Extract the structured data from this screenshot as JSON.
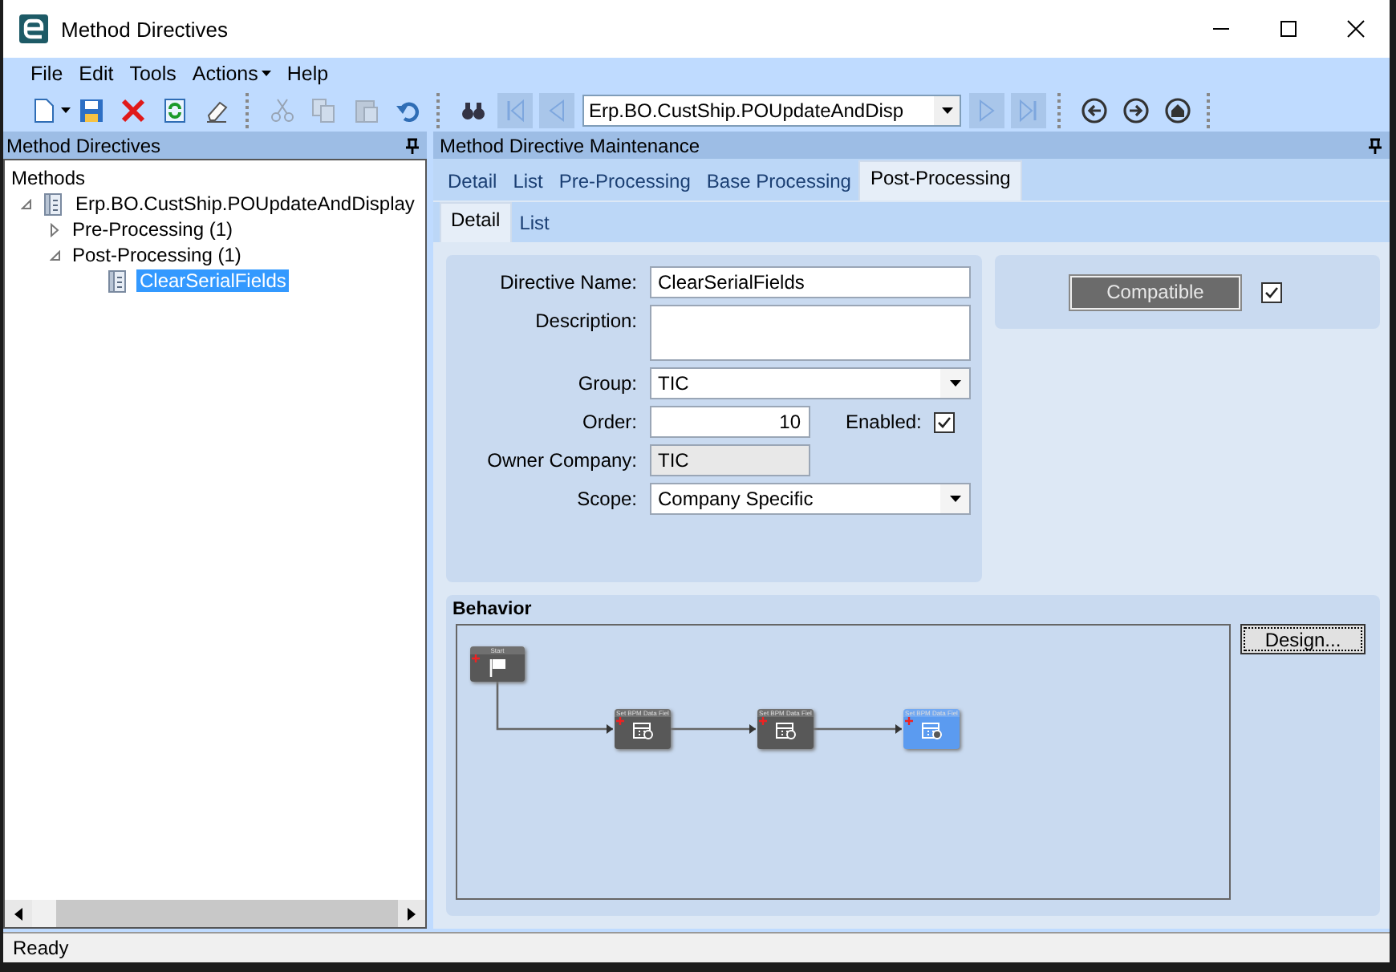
{
  "window": {
    "title": "Method Directives"
  },
  "menu": [
    {
      "label": "File",
      "has_dropdown": false
    },
    {
      "label": "Edit",
      "has_dropdown": false
    },
    {
      "label": "Tools",
      "has_dropdown": false
    },
    {
      "label": "Actions",
      "has_dropdown": true
    },
    {
      "label": "Help",
      "has_dropdown": false
    }
  ],
  "toolbar": [
    {
      "kind": "new",
      "disabled": false
    },
    {
      "kind": "save",
      "disabled": false
    },
    {
      "kind": "delete",
      "disabled": false
    },
    {
      "kind": "refresh",
      "disabled": false
    },
    {
      "kind": "clear",
      "disabled": false
    },
    {
      "kind": "separator"
    },
    {
      "kind": "cut",
      "disabled": true
    },
    {
      "kind": "copy",
      "disabled": true
    },
    {
      "kind": "paste",
      "disabled": true
    },
    {
      "kind": "undo",
      "disabled": false
    },
    {
      "kind": "separator"
    },
    {
      "kind": "search",
      "disabled": false
    },
    {
      "kind": "first",
      "disabled": true
    },
    {
      "kind": "previous",
      "disabled": true
    },
    {
      "kind": "navigator",
      "value": "Erp.BO.CustShip.POUpdateAndDisp"
    },
    {
      "kind": "next",
      "disabled": true
    },
    {
      "kind": "last",
      "disabled": true
    },
    {
      "kind": "separator"
    },
    {
      "kind": "back",
      "disabled": false
    },
    {
      "kind": "forward",
      "disabled": false
    },
    {
      "kind": "home",
      "disabled": false
    },
    {
      "kind": "separator"
    }
  ],
  "left_panel": {
    "title": "Method Directives",
    "tree": [
      {
        "label": "Methods",
        "kind": "root",
        "selected": false,
        "children": [
          {
            "label": "Erp.BO.CustShip.POUpdateAndDisplay",
            "kind": "method",
            "selected": false,
            "expanded": true,
            "children": [
              {
                "label": "Pre-Processing (1)",
                "kind": "group",
                "selected": false,
                "expanded": false
              },
              {
                "label": "Post-Processing (1)",
                "kind": "group",
                "selected": false,
                "expanded": true,
                "children": [
                  {
                    "label": "ClearSerialFields",
                    "kind": "directive",
                    "selected": true
                  }
                ]
              }
            ]
          }
        ]
      }
    ]
  },
  "right_panel": {
    "title": "Method Directive Maintenance",
    "tabs": [
      {
        "label": "Detail",
        "selected": false
      },
      {
        "label": "List",
        "selected": false
      },
      {
        "label": "Pre-Processing",
        "selected": false
      },
      {
        "label": "Base Processing",
        "selected": false
      },
      {
        "label": "Post-Processing",
        "selected": true
      }
    ],
    "subtabs": [
      {
        "label": "Detail",
        "selected": true
      },
      {
        "label": "List",
        "selected": false
      }
    ],
    "form": {
      "fields": [
        {
          "label": "Directive Name:",
          "kind": "text",
          "value": "ClearSerialFields"
        },
        {
          "label": "Description:",
          "kind": "textarea"
        },
        {
          "label": "Group:",
          "kind": "dropdown",
          "value": "TIC"
        },
        {
          "label": "Order:",
          "kind": "number",
          "value": "10"
        },
        {
          "label": "Owner Company:",
          "kind": "readonly",
          "value": "TIC"
        },
        {
          "label": "Scope:",
          "kind": "dropdown",
          "value": "Company Specific"
        }
      ],
      "enabled": {
        "label": "Enabled:",
        "checked": true
      }
    },
    "compatible": {
      "label": "Compatible",
      "checked": true
    },
    "behavior": {
      "title": "Behavior",
      "design_button": "Design...",
      "nodes": [
        {
          "title": "Start",
          "kind": "start",
          "selected": false
        },
        {
          "title": "Set BPM Data Fiel",
          "kind": "action",
          "selected": false
        },
        {
          "title": "Set BPM Data Fiel",
          "kind": "action",
          "selected": false
        },
        {
          "title": "Set BPM Data Fiel",
          "kind": "action",
          "selected": true
        }
      ]
    }
  },
  "status_bar": "Ready"
}
